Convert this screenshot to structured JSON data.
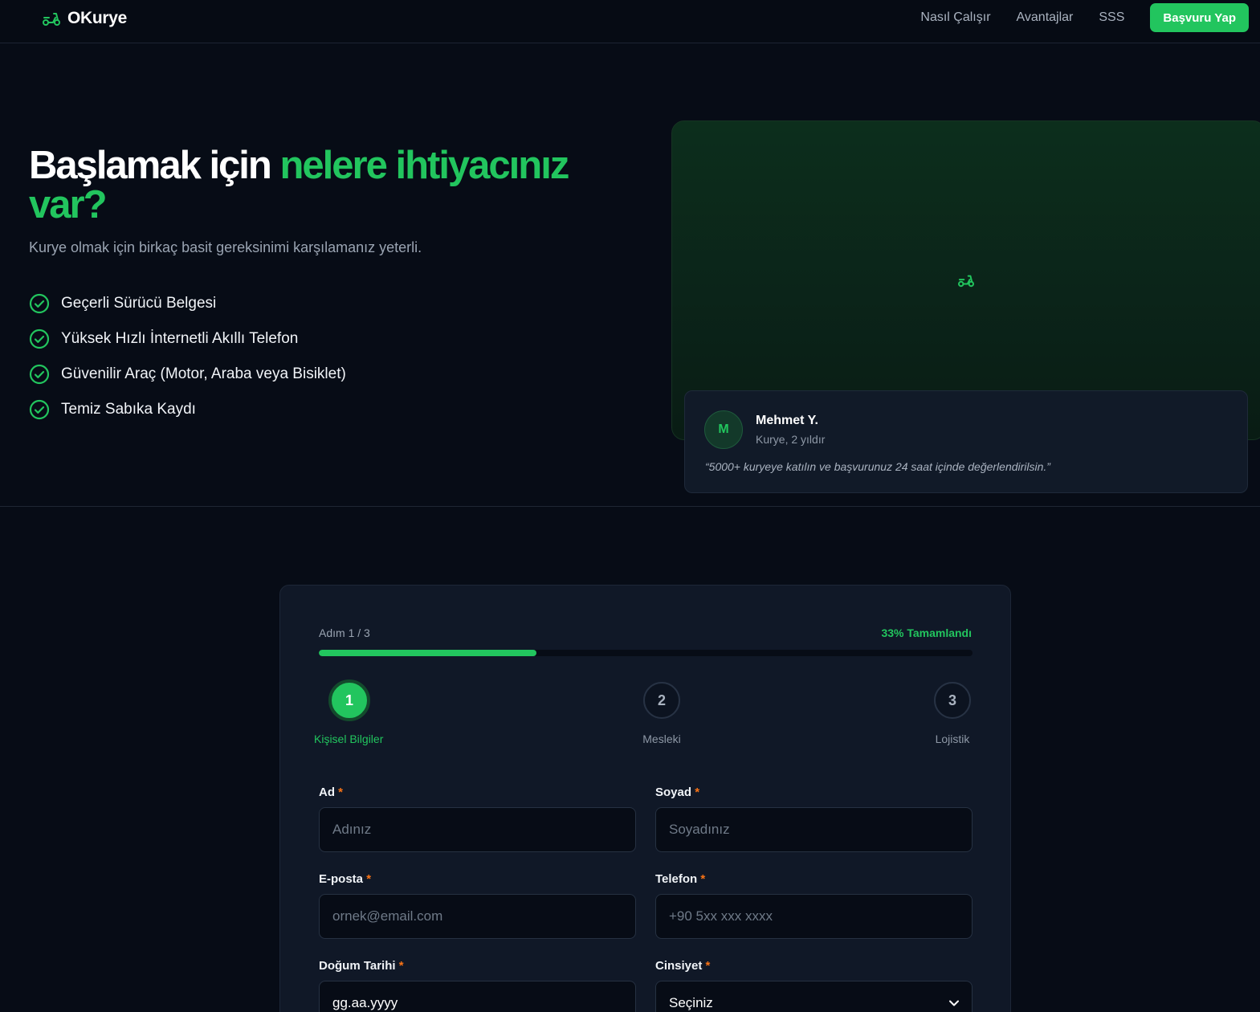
{
  "header": {
    "brand": "OKurye",
    "nav": [
      "Nasıl Çalışır",
      "Avantajlar",
      "SSS"
    ],
    "cta": "Başvuru Yap"
  },
  "hero": {
    "title_plain": "Başlamak için ",
    "title_accent": "nelere ihtiyacınız var?",
    "subtitle": "Kurye olmak için birkaç basit gereksinimi karşılamanız yeterli.",
    "requirements": [
      "Geçerli Sürücü Belgesi",
      "Yüksek Hızlı İnternetli Akıllı Telefon",
      "Güvenilir Araç (Motor, Araba veya Bisiklet)",
      "Temiz Sabıka Kaydı"
    ]
  },
  "testimonial": {
    "initial": "M",
    "name": "Mehmet Y.",
    "role": "Kurye, 2 yıldır",
    "quote": "“5000+ kuryeye katılın ve başvurunuz 24 saat içinde değerlendirilsin.”"
  },
  "form": {
    "step_label": "Adım 1 / 3",
    "progress_label": "33% Tamamlandı",
    "progress": 0.333,
    "steps": [
      {
        "number": "1",
        "name": "Kişisel Bilgiler"
      },
      {
        "number": "2",
        "name": "Mesleki"
      },
      {
        "number": "3",
        "name": "Lojistik"
      }
    ],
    "required_mark": "*",
    "fields": {
      "first_name": {
        "label": "Ad",
        "placeholder": "Adınız"
      },
      "last_name": {
        "label": "Soyad",
        "placeholder": "Soyadınız"
      },
      "email": {
        "label": "E-posta",
        "placeholder": "ornek@email.com"
      },
      "phone": {
        "label": "Telefon",
        "placeholder": "+90 5xx xxx xxxx"
      },
      "birth_date": {
        "label": "Doğum Tarihi",
        "placeholder": "gg.aa.yyyy"
      },
      "gender": {
        "label": "Cinsiyet",
        "selected": "Seçiniz"
      }
    }
  },
  "colors": {
    "accent": "#22c55e",
    "background": "#070c16",
    "card": "#101827",
    "required": "#f97316"
  },
  "icons": {
    "brand": "scooter-icon",
    "requirement": "check-circle-icon",
    "select": "chevron-down-icon"
  }
}
